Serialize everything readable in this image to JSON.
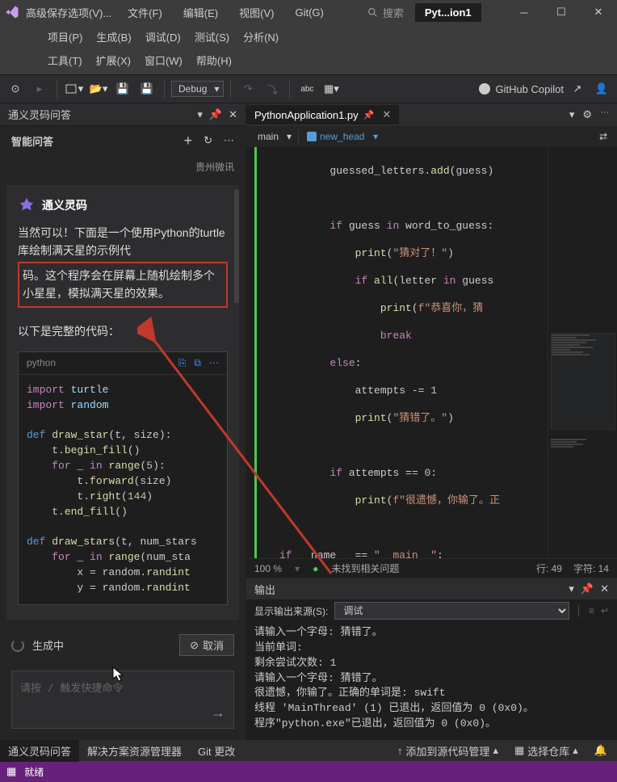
{
  "titlebar": {
    "save_menu": "高级保存选项(V)...",
    "app_tab": "Pyt...ion1"
  },
  "menu1": [
    "文件(F)",
    "编辑(E)",
    "视图(V)",
    "Git(G)"
  ],
  "menu2": [
    "项目(P)",
    "生成(B)",
    "调试(D)",
    "测试(S)",
    "分析(N)"
  ],
  "menu3": [
    "工具(T)",
    "扩展(X)",
    "窗口(W)",
    "帮助(H)"
  ],
  "search_placeholder": "搜索",
  "toolbar": {
    "config": "Debug",
    "copilot": "GitHub Copilot"
  },
  "left": {
    "panel_title": "通义灵码问答",
    "chat_title": "智能问答",
    "brand": "贵州微讯",
    "ai_name": "通义灵码",
    "response_p1": "当然可以！下面是一个使用Python的turtle库绘制满天星的示例代",
    "response_p2": "码。这个程序会在屏幕上随机绘制多个小星星，模拟满天星的效果。",
    "response_p3": "以下是完整的代码：",
    "code_lang": "python",
    "code": "import turtle\nimport random\n\ndef draw_star(t, size):\n    t.begin_fill()\n    for _ in range(5):\n        t.forward(size)\n        t.right(144)\n    t.end_fill()\n\ndef draw_stars(t, num_stars\n    for _ in range(num_sta\n        x = random.randint\n        y = random.randint",
    "generating": "生成中",
    "cancel": "取消",
    "input_placeholder": "请按 / 触发快捷命令"
  },
  "editor": {
    "tab_name": "PythonApplication1.py",
    "nav_main": "main",
    "nav_symbol": "new_head",
    "zoom": "100 %",
    "status_msg": "未找到相关问题",
    "line_col": "行: 49",
    "char": "字符: 14"
  },
  "output": {
    "title": "输出",
    "src_label": "显示输出来源(S):",
    "src_value": "调试",
    "text": "请输入一个字母: 猜错了。\n当前单词:\n剩余尝试次数: 1\n请输入一个字母: 猜错了。\n很遗憾，你输了。正确的单词是: swift\n线程 'MainThread' (1) 已退出，返回值为 0 (0x0)。\n程序\"python.exe\"已退出，返回值为 0 (0x0)。"
  },
  "bottom_tabs": [
    "通义灵码问答",
    "解决方案资源管理器",
    "Git 更改"
  ],
  "statusbar": {
    "ready": "就绪",
    "add_src": "添加到源代码管理",
    "select_repo": "选择仓库"
  }
}
